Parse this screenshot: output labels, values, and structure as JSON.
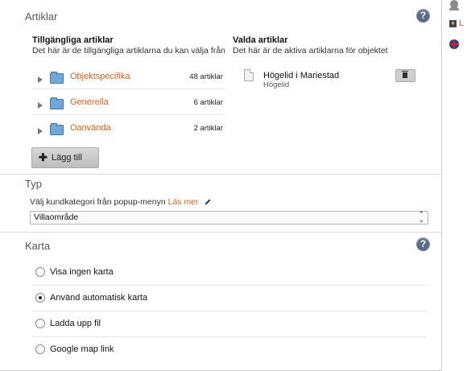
{
  "artiklar": {
    "title": "Artiklar",
    "help": "?",
    "available_heading": "Tillgängliga artiklar",
    "available_sub": "Det här är de tillgängliga artiklarna du kan välja från",
    "selected_heading": "Valda artiklar",
    "selected_sub": "Det här är de aktiva artiklarna för objektet",
    "items": [
      {
        "name": "Objektspecifika",
        "count": "48 artiklar"
      },
      {
        "name": "Generella",
        "count": "6 artiklar"
      },
      {
        "name": "Oanvända",
        "count": "2 artiklar"
      }
    ],
    "add_button": "Lägg till",
    "add_plus": "✚",
    "selected_item": {
      "title": "Högelid i Mariestad",
      "subtitle": "Högelid"
    }
  },
  "typ": {
    "title": "Typ",
    "instruction": "Välj kundkategori från popup-menyn",
    "link": "Läs mer",
    "select_value": "Villaområde",
    "select_arrows": "⌃⌄"
  },
  "karta": {
    "title": "Karta",
    "help": "?",
    "options": [
      {
        "label": "Visa ingen karta",
        "selected": false
      },
      {
        "label": "Använd automatisk karta",
        "selected": true
      },
      {
        "label": "Ladda upp fil",
        "selected": false
      },
      {
        "label": "Google map link",
        "selected": false
      }
    ]
  },
  "colors": {
    "accent": "#e0611d",
    "help": "#5a6c8a"
  }
}
